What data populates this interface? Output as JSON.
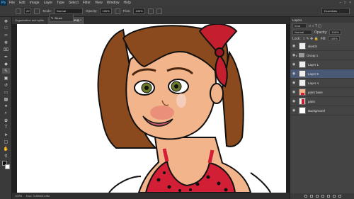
{
  "app": {
    "logo": "Ps"
  },
  "menu": [
    "File",
    "Edit",
    "Image",
    "Layer",
    "Type",
    "Select",
    "Filter",
    "View",
    "Window",
    "Help"
  ],
  "options": {
    "brush_size": "20",
    "mode_label": "Mode:",
    "mode_value": "Normal",
    "opacity_label": "Opacity:",
    "opacity_value": "100%",
    "flow_label": "Flow:",
    "flow_value": "100%",
    "workspace": "Essentials"
  },
  "tooltip": {
    "label": "Brush"
  },
  "tabs": [
    {
      "label": "Organization and splits"
    },
    {
      "label": "100% (Layer 5, RGB/8) *",
      "active": true
    }
  ],
  "status": {
    "zoom": "100%",
    "doc": "Doc: 3.49M/31.8M"
  },
  "layers_panel": {
    "title": "Layers",
    "kind": "Kind",
    "blend": "Normal",
    "opacity_label": "Opacity:",
    "opacity": "100%",
    "lock_label": "Lock:",
    "fill_label": "Fill:",
    "fill": "100%",
    "layers": [
      {
        "name": "sketch",
        "type": "layer",
        "thumb": "sketch"
      },
      {
        "name": "Group 1",
        "type": "group"
      },
      {
        "name": "Layer 1",
        "type": "layer",
        "thumb": "blank"
      },
      {
        "name": "Layer 5",
        "type": "layer",
        "thumb": "blank",
        "active": true
      },
      {
        "name": "Layer 4",
        "type": "layer",
        "thumb": "blank"
      },
      {
        "name": "paint base",
        "type": "layer",
        "thumb": "figure"
      },
      {
        "name": "paint",
        "type": "layer",
        "thumb": "figure"
      },
      {
        "name": "Background",
        "type": "layer",
        "thumb": "white"
      }
    ]
  },
  "colors": {
    "accent": "#4a5a76",
    "hair": "#8b4a1e",
    "skin": "#f2b48a",
    "dress": "#d21f35",
    "bow": "#c51e2e"
  }
}
